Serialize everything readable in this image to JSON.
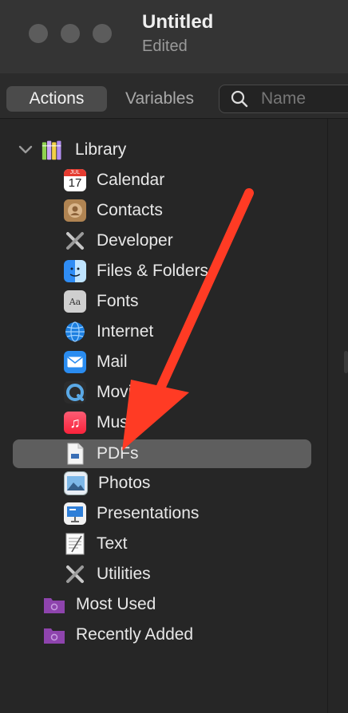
{
  "window": {
    "title": "Untitled",
    "subtitle": "Edited"
  },
  "toolbar": {
    "actions_label": "Actions",
    "variables_label": "Variables",
    "search_placeholder": "Name"
  },
  "library": {
    "label": "Library",
    "items": [
      {
        "label": "Calendar",
        "icon": "calendar-icon",
        "calendar_month": "JUL",
        "calendar_day": "17"
      },
      {
        "label": "Contacts",
        "icon": "contacts-icon"
      },
      {
        "label": "Developer",
        "icon": "developer-tools-icon"
      },
      {
        "label": "Files & Folders",
        "icon": "finder-icon"
      },
      {
        "label": "Fonts",
        "icon": "fonts-icon"
      },
      {
        "label": "Internet",
        "icon": "internet-globe-icon"
      },
      {
        "label": "Mail",
        "icon": "mail-icon"
      },
      {
        "label": "Movies",
        "icon": "quicktime-icon"
      },
      {
        "label": "Music",
        "icon": "music-icon"
      },
      {
        "label": "PDFs",
        "icon": "pdf-document-icon",
        "selected": true
      },
      {
        "label": "Photos",
        "icon": "photos-icon"
      },
      {
        "label": "Presentations",
        "icon": "presentation-icon"
      },
      {
        "label": "Text",
        "icon": "text-document-icon"
      },
      {
        "label": "Utilities",
        "icon": "utilities-tools-icon"
      }
    ]
  },
  "smart_folders": [
    {
      "label": "Most Used",
      "icon": "smart-folder-icon"
    },
    {
      "label": "Recently Added",
      "icon": "smart-folder-icon"
    }
  ],
  "colors": {
    "annotation_arrow": "#ff3b24",
    "selection": "#5e5e5e",
    "smart_folder": "#8e44ad"
  }
}
